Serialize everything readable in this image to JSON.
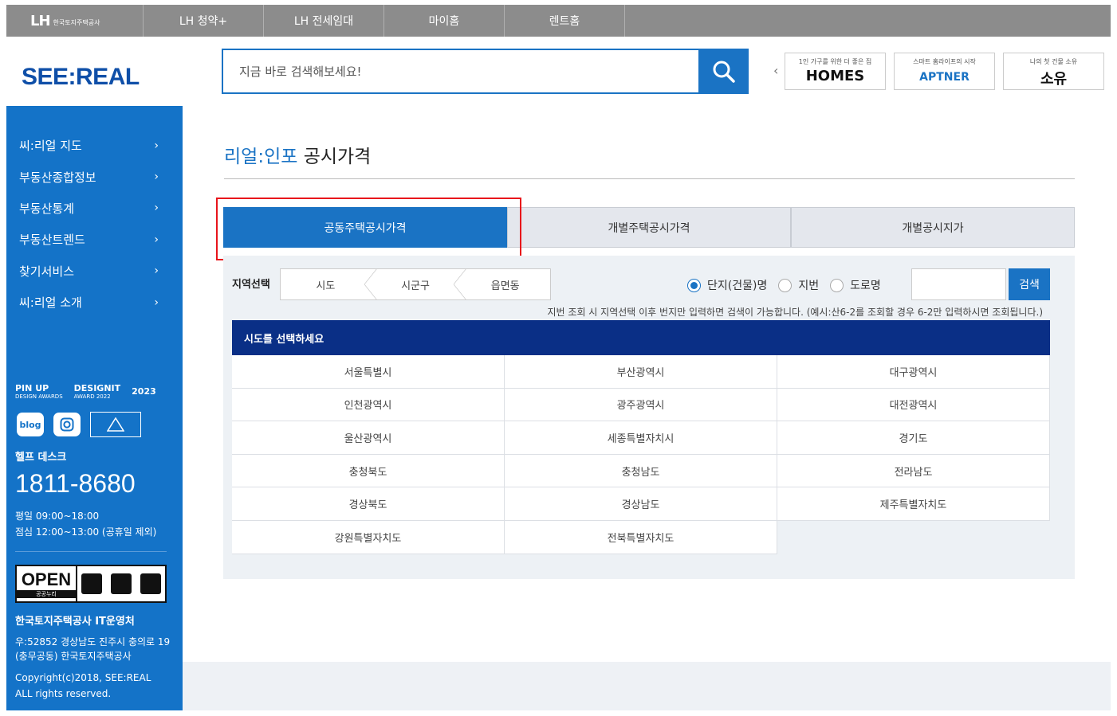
{
  "topbar": {
    "logo": "LH",
    "logo_sub": "한국토지주택공사",
    "nav": [
      "LH 청약+",
      "LH 전세임대",
      "마이홈",
      "렌트홈"
    ]
  },
  "header": {
    "brand": "SEE:REAL",
    "search_placeholder": "지금 바로 검색해보세요!",
    "promos": [
      {
        "top": "1인 가구를 위한 더 좋은 집",
        "bottom": "HOMES"
      },
      {
        "top": "스마트 홈라이프의 시작",
        "bottom": "APTNER"
      },
      {
        "top": "나의 첫 건물 소유",
        "bottom": "소유"
      }
    ]
  },
  "sidebar": {
    "menu": [
      "씨:리얼 지도",
      "부동산종합정보",
      "부동산통계",
      "부동산트렌드",
      "찾기서비스",
      "씨:리얼 소개"
    ],
    "awards": {
      "pinup": "PIN UP",
      "pinup_sub": "DESIGN AWARDS",
      "designit": "DESIGNIT",
      "designit_sub": "AWARD 2022",
      "german": "2023"
    },
    "blog": "blog",
    "help_title": "헬프 데스크",
    "help_phone": "1811-8680",
    "help_hours_1": "평일 09:00~18:00",
    "help_hours_2": "점심 12:00~13:00 (공휴일 제외)",
    "open_title": "OPEN",
    "open_sub": "공공누리",
    "org": "한국토지주택공사 IT운영처",
    "address": "우:52852 경상남도 진주시 충의로 19 (충무공동) 한국토지주택공사",
    "copyright_1": "Copyright(c)2018, SEE:REAL",
    "copyright_2": "ALL rights reserved."
  },
  "main": {
    "title_accent": "리얼:인포",
    "title_rest": "공시가격",
    "tabs": [
      "공동주택공시가격",
      "개별주택공시가격",
      "개별공시지가"
    ],
    "region_label": "지역선택",
    "crumbs": [
      "시도",
      "시군구",
      "읍면동"
    ],
    "radios": [
      "단지(건물)명",
      "지번",
      "도로명"
    ],
    "search_button": "검색",
    "hint": "지번 조회 시 지역선택 이후 번지만 입력하면 검색이 가능합니다. (예시:산6-2를 조회할 경우 6-2만 입력하시면 조회됩니다.)",
    "sido_header": "시도를 선택하세요",
    "sido": [
      "서울특별시",
      "부산광역시",
      "대구광역시",
      "인천광역시",
      "광주광역시",
      "대전광역시",
      "울산광역시",
      "세종특별자치시",
      "경기도",
      "충청북도",
      "충청남도",
      "전라남도",
      "경상북도",
      "경상남도",
      "제주특별자치도",
      "강원특별자치도",
      "전북특별자치도"
    ]
  }
}
